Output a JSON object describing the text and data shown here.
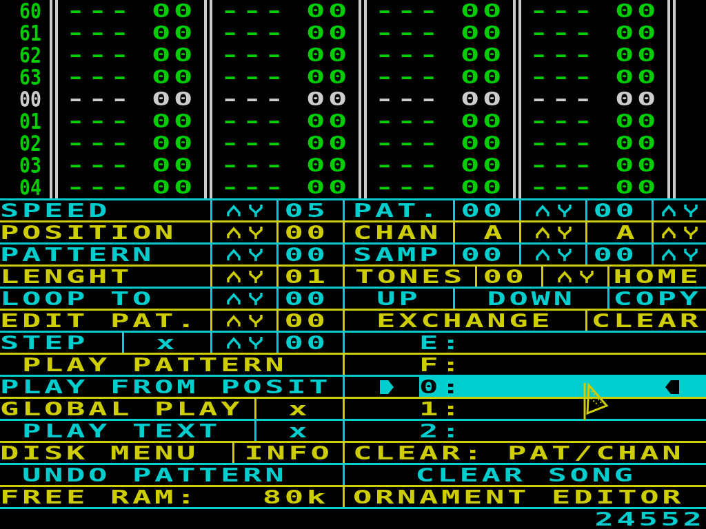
{
  "tracker": {
    "rows": [
      {
        "number": "60",
        "selected": false,
        "channels": [
          [
            "---",
            "00"
          ],
          [
            "---",
            "00"
          ],
          [
            "---",
            "00"
          ],
          [
            "---",
            "00"
          ]
        ]
      },
      {
        "number": "61",
        "selected": false,
        "channels": [
          [
            "---",
            "00"
          ],
          [
            "---",
            "00"
          ],
          [
            "---",
            "00"
          ],
          [
            "---",
            "00"
          ]
        ]
      },
      {
        "number": "62",
        "selected": false,
        "channels": [
          [
            "---",
            "00"
          ],
          [
            "---",
            "00"
          ],
          [
            "---",
            "00"
          ],
          [
            "---",
            "00"
          ]
        ]
      },
      {
        "number": "63",
        "selected": false,
        "channels": [
          [
            "---",
            "00"
          ],
          [
            "---",
            "00"
          ],
          [
            "---",
            "00"
          ],
          [
            "---",
            "00"
          ]
        ]
      },
      {
        "number": "00",
        "selected": true,
        "channels": [
          [
            "---",
            "00"
          ],
          [
            "---",
            "00"
          ],
          [
            "---",
            "00"
          ],
          [
            "---",
            "00"
          ]
        ]
      },
      {
        "number": "01",
        "selected": false,
        "channels": [
          [
            "---",
            "00"
          ],
          [
            "---",
            "00"
          ],
          [
            "---",
            "00"
          ],
          [
            "---",
            "00"
          ]
        ]
      },
      {
        "number": "02",
        "selected": false,
        "channels": [
          [
            "---",
            "00"
          ],
          [
            "---",
            "00"
          ],
          [
            "---",
            "00"
          ],
          [
            "---",
            "00"
          ]
        ]
      },
      {
        "number": "03",
        "selected": false,
        "channels": [
          [
            "---",
            "00"
          ],
          [
            "---",
            "00"
          ],
          [
            "---",
            "00"
          ],
          [
            "---",
            "00"
          ]
        ]
      },
      {
        "number": "04",
        "selected": false,
        "channels": [
          [
            "---",
            "00"
          ],
          [
            "---",
            "00"
          ],
          [
            "---",
            "00"
          ],
          [
            "---",
            "00"
          ]
        ]
      }
    ]
  },
  "left_panel": [
    {
      "cells": [
        {
          "kind": "label",
          "text": "SPEED"
        },
        {
          "kind": "arrows"
        },
        {
          "kind": "value",
          "text": "05"
        }
      ]
    },
    {
      "cells": [
        {
          "kind": "label",
          "text": "POSITION"
        },
        {
          "kind": "arrows"
        },
        {
          "kind": "value",
          "text": "00"
        }
      ]
    },
    {
      "cells": [
        {
          "kind": "label",
          "text": "PATTERN"
        },
        {
          "kind": "arrows"
        },
        {
          "kind": "value",
          "text": "00"
        }
      ]
    },
    {
      "cells": [
        {
          "kind": "label",
          "text": "LENGHT"
        },
        {
          "kind": "arrows"
        },
        {
          "kind": "value",
          "text": "01"
        }
      ]
    },
    {
      "cells": [
        {
          "kind": "label",
          "text": "LOOP TO"
        },
        {
          "kind": "arrows"
        },
        {
          "kind": "value",
          "text": "00"
        }
      ]
    },
    {
      "cells": [
        {
          "kind": "label",
          "text": "EDIT PAT."
        },
        {
          "kind": "arrows"
        },
        {
          "kind": "value",
          "text": "00"
        }
      ]
    },
    {
      "cells": [
        {
          "kind": "label",
          "text": "STEP"
        },
        {
          "kind": "flag",
          "text": "x"
        },
        {
          "kind": "arrows"
        },
        {
          "kind": "value",
          "text": "00"
        }
      ]
    },
    {
      "cells": [
        {
          "kind": "button",
          "text": "PLAY PATTERN"
        }
      ]
    },
    {
      "cells": [
        {
          "kind": "button",
          "text": "PLAY FROM POSIT"
        }
      ]
    },
    {
      "cells": [
        {
          "kind": "button",
          "text": "GLOBAL PLAY"
        },
        {
          "kind": "flag",
          "text": "x"
        }
      ]
    },
    {
      "cells": [
        {
          "kind": "button",
          "text": "PLAY TEXT"
        },
        {
          "kind": "flag",
          "text": "x"
        }
      ]
    },
    {
      "cells": [
        {
          "kind": "button",
          "text": "DISK MENU"
        },
        {
          "kind": "button",
          "text": "INFO"
        }
      ]
    },
    {
      "cells": [
        {
          "kind": "button",
          "text": "UNDO PATTERN"
        }
      ]
    },
    {
      "cells": [
        {
          "kind": "label",
          "text": "FREE RAM:"
        },
        {
          "kind": "value",
          "text": "80k"
        }
      ]
    }
  ],
  "right_panel": [
    {
      "kind": "cells",
      "cells": [
        {
          "kind": "label",
          "text": "PAT."
        },
        {
          "kind": "value",
          "text": "00"
        },
        {
          "kind": "arrows"
        },
        {
          "kind": "value",
          "text": "00"
        },
        {
          "kind": "arrows"
        }
      ]
    },
    {
      "kind": "cells",
      "cells": [
        {
          "kind": "label",
          "text": "CHAN"
        },
        {
          "kind": "value",
          "text": "A"
        },
        {
          "kind": "arrows"
        },
        {
          "kind": "value",
          "text": "A"
        },
        {
          "kind": "arrows"
        }
      ]
    },
    {
      "kind": "cells",
      "cells": [
        {
          "kind": "label",
          "text": "SAMP"
        },
        {
          "kind": "value",
          "text": "00"
        },
        {
          "kind": "arrows"
        },
        {
          "kind": "value",
          "text": "00"
        },
        {
          "kind": "arrows"
        }
      ]
    },
    {
      "kind": "cells",
      "cells": [
        {
          "kind": "label",
          "text": "TONES"
        },
        {
          "kind": "value",
          "text": "00"
        },
        {
          "kind": "arrows"
        },
        {
          "kind": "button",
          "text": "HOME"
        }
      ]
    },
    {
      "kind": "cells",
      "cells": [
        {
          "kind": "button",
          "text": "UP"
        },
        {
          "kind": "button",
          "text": "DOWN"
        },
        {
          "kind": "button",
          "text": "COPY"
        }
      ]
    },
    {
      "kind": "cells",
      "cells": [
        {
          "kind": "button",
          "text": "EXCHANGE"
        },
        {
          "kind": "button",
          "text": "CLEAR"
        }
      ]
    },
    {
      "kind": "slot",
      "text": "E:",
      "selected": false
    },
    {
      "kind": "slot",
      "text": "F:",
      "selected": false
    },
    {
      "kind": "slot",
      "text": "0:",
      "selected": true
    },
    {
      "kind": "slot",
      "text": "1:",
      "selected": false
    },
    {
      "kind": "slot",
      "text": "2:",
      "selected": false
    },
    {
      "kind": "cells",
      "cells": [
        {
          "kind": "button",
          "text": "CLEAR: PAT/CHAN"
        }
      ]
    },
    {
      "kind": "cells",
      "cells": [
        {
          "kind": "button",
          "text": "CLEAR SONG"
        }
      ]
    },
    {
      "kind": "cells",
      "cells": [
        {
          "kind": "button",
          "text": "ORNAMENT EDITOR"
        }
      ]
    }
  ],
  "counter": "24552"
}
